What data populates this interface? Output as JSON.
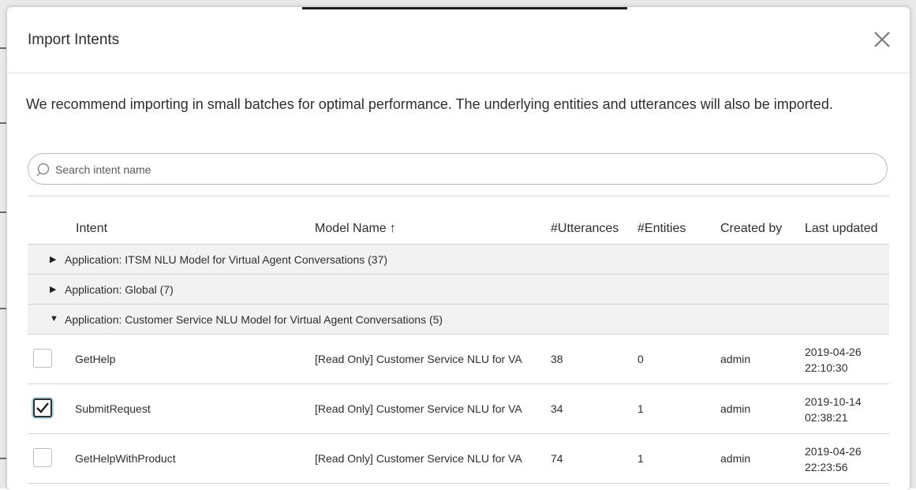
{
  "dialog": {
    "title": "Import Intents",
    "intro": "We recommend importing in small batches for optimal performance. The underlying entities and utterances will also be imported."
  },
  "search": {
    "placeholder": "Search intent name",
    "value": ""
  },
  "columns": {
    "intent": "Intent",
    "model_name": "Model Name",
    "sort_arrow": "↑",
    "utterances": "#Utterances",
    "entities": "#Entities",
    "created_by": "Created by",
    "last_updated": "Last updated"
  },
  "groups": [
    {
      "label": "Application: ITSM NLU Model for Virtual Agent Conversations (37)",
      "expanded": false
    },
    {
      "label": "Application: Global (7)",
      "expanded": false
    },
    {
      "label": "Application: Customer Service NLU Model for Virtual Agent Conversations (5)",
      "expanded": true
    }
  ],
  "rows": [
    {
      "intent": "GetHelp",
      "model": "[Read Only] Customer Service NLU for VA",
      "utterances": "38",
      "entities": "0",
      "created_by": "admin",
      "date": "2019-04-26",
      "time": "22:10:30",
      "checked": false
    },
    {
      "intent": "SubmitRequest",
      "model": "[Read Only] Customer Service NLU for VA",
      "utterances": "34",
      "entities": "1",
      "created_by": "admin",
      "date": "2019-10-14",
      "time": "02:38:21",
      "checked": true
    },
    {
      "intent": "GetHelpWithProduct",
      "model": "[Read Only] Customer Service NLU for VA",
      "utterances": "74",
      "entities": "1",
      "created_by": "admin",
      "date": "2019-04-26",
      "time": "22:23:56",
      "checked": false
    }
  ],
  "icons": {
    "close": "close-icon",
    "search": "search-icon",
    "expand_collapsed": "caret-right-icon",
    "expand_open": "caret-down-icon",
    "checkmark": "checkmark-icon"
  },
  "colors": {
    "group_bg": "#f2f2f2",
    "focus_ring": "#b5d9e4",
    "text": "#2e2e2e"
  }
}
